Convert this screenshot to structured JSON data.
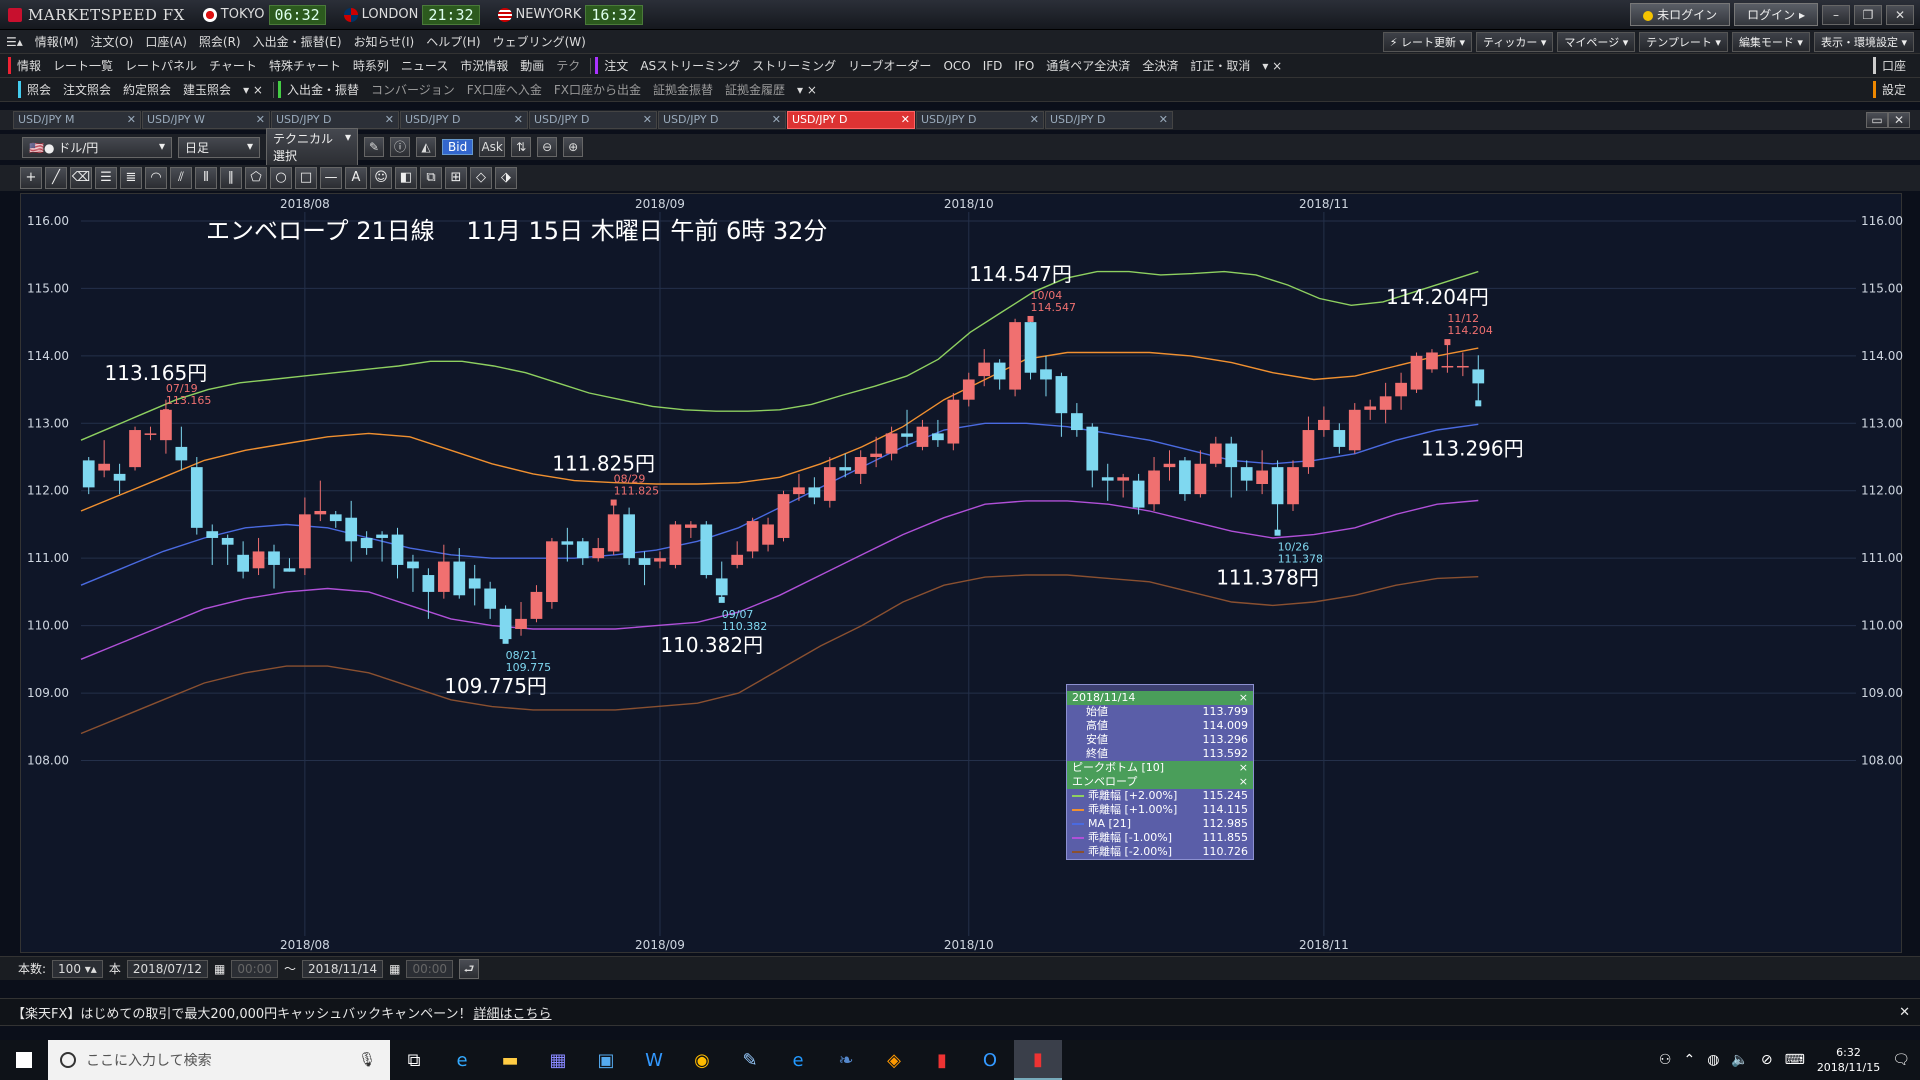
{
  "titlebar": {
    "app_name": "MARKETSPEED FX",
    "clocks": [
      {
        "city": "TOKYO",
        "time": "06:32"
      },
      {
        "city": "LONDON",
        "time": "21:32"
      },
      {
        "city": "NEWYORK",
        "time": "16:32"
      }
    ],
    "login_status": "未ログイン",
    "login_button": "ログイン"
  },
  "menubar": {
    "items": [
      "情報(M)",
      "注文(O)",
      "口座(A)",
      "照会(R)",
      "入出金・振替(E)",
      "お知らせ(I)",
      "ヘルプ(H)",
      "ウェブリング(W)"
    ],
    "right": [
      "レート更新",
      "ティッカー",
      "マイページ",
      "テンプレート",
      "編集モード",
      "表示・環境設定"
    ]
  },
  "funcbar": {
    "info_label": "情報",
    "info_items": [
      "レート一覧",
      "レートパネル",
      "チャート",
      "特殊チャート",
      "時系列",
      "ニュース",
      "市況情報",
      "動画",
      "テク"
    ],
    "order_label": "注文",
    "order_items": [
      "ASストリーミング",
      "ストリーミング",
      "リーブオーダー",
      "OCO",
      "IFD",
      "IFO",
      "通貨ペア全決済",
      "全決済",
      "訂正・取消"
    ],
    "right_label": "口座"
  },
  "funcbar2": {
    "inquiry_label": "照会",
    "inquiry_items": [
      "注文照会",
      "約定照会",
      "建玉照会"
    ],
    "transfer_label": "入出金・振替",
    "transfer_items": [
      "コンバージョン",
      "FX口座へ入金",
      "FX口座から出金",
      "証拠金振替",
      "証拠金履歴"
    ],
    "right_label": "設定"
  },
  "tabs": [
    "USD/JPY M",
    "USD/JPY W",
    "USD/JPY D",
    "USD/JPY D",
    "USD/JPY D",
    "USD/JPY D",
    "USD/JPY D",
    "USD/JPY D",
    "USD/JPY D"
  ],
  "active_tab_index": 6,
  "chart_tools": {
    "pair": "ドル/円",
    "period": "日足",
    "technical": "テクニカル選択",
    "bid": "Bid",
    "ask": "Ask"
  },
  "range": {
    "count_label": "本数:",
    "count_value": "100",
    "count_unit": "本",
    "from": "2018/07/12",
    "from_time": "00:00",
    "tilde": "～",
    "to": "2018/11/14",
    "to_time": "00:00"
  },
  "news": {
    "text": "【楽天FX】はじめての取引で最大200,000円キャッシュバックキャンペーン！",
    "link": "詳細はこちら"
  },
  "taskbar": {
    "search_placeholder": "ここに入力して検索",
    "time": "6:32",
    "date": "2018/11/15"
  },
  "colors": {
    "up_candle": "#f07070",
    "down_candle": "#7fd8f0",
    "env_plus2": "#8ed060",
    "env_plus1": "#f09030",
    "ma21": "#4a6ae0",
    "env_minus1": "#b050d8",
    "env_minus2": "#8a5030"
  },
  "chart_data": {
    "type": "candlestick",
    "title": "エンベロープ 21日線　 11月 15日 木曜日 午前 6時 32分",
    "yrange": [
      107.8,
      116.4
    ],
    "yticks": [
      "116.00",
      "115.00",
      "114.00",
      "113.00",
      "112.00",
      "111.00",
      "110.00",
      "109.00",
      "108.00"
    ],
    "month_labels": [
      {
        "label": "2018/08",
        "index": 14
      },
      {
        "label": "2018/09",
        "index": 37
      },
      {
        "label": "2018/10",
        "index": 57
      },
      {
        "label": "2018/11",
        "index": 80
      }
    ],
    "candles": [
      [
        112.45,
        112.05,
        112.5,
        111.95
      ],
      [
        112.3,
        112.4,
        112.75,
        112.2
      ],
      [
        112.25,
        112.15,
        112.4,
        111.95
      ],
      [
        112.35,
        112.9,
        112.95,
        112.3
      ],
      [
        112.85,
        112.85,
        112.95,
        112.75
      ],
      [
        112.75,
        113.2,
        113.35,
        112.55
      ],
      [
        112.65,
        112.45,
        112.95,
        112.3
      ],
      [
        112.35,
        111.45,
        112.5,
        111.35
      ],
      [
        111.4,
        111.3,
        111.5,
        110.9
      ],
      [
        111.3,
        111.2,
        111.35,
        110.9
      ],
      [
        111.05,
        110.8,
        111.25,
        110.7
      ],
      [
        110.85,
        111.1,
        111.3,
        110.75
      ],
      [
        111.1,
        110.9,
        111.2,
        110.55
      ],
      [
        110.85,
        110.8,
        111.0,
        110.8
      ],
      [
        110.85,
        111.65,
        111.9,
        110.75
      ],
      [
        111.65,
        111.7,
        112.15,
        111.55
      ],
      [
        111.65,
        111.55,
        111.7,
        111.45
      ],
      [
        111.6,
        111.25,
        111.85,
        110.95
      ],
      [
        111.3,
        111.15,
        111.4,
        111.05
      ],
      [
        111.35,
        111.3,
        111.4,
        110.95
      ],
      [
        111.35,
        110.9,
        111.45,
        110.7
      ],
      [
        110.95,
        110.85,
        111.05,
        110.5
      ],
      [
        110.75,
        110.5,
        110.85,
        110.1
      ],
      [
        110.5,
        110.95,
        111.2,
        110.4
      ],
      [
        110.95,
        110.45,
        111.15,
        110.4
      ],
      [
        110.7,
        110.55,
        110.9,
        110.3
      ],
      [
        110.55,
        110.25,
        110.65,
        110.1
      ],
      [
        110.25,
        109.8,
        110.3,
        109.78
      ],
      [
        109.95,
        110.1,
        110.35,
        109.85
      ],
      [
        110.1,
        110.5,
        110.6,
        110.05
      ],
      [
        110.35,
        111.25,
        111.3,
        110.25
      ],
      [
        111.25,
        111.2,
        111.45,
        110.95
      ],
      [
        111.25,
        111.0,
        111.3,
        110.9
      ],
      [
        111.0,
        111.15,
        111.3,
        110.95
      ],
      [
        111.1,
        111.65,
        111.83,
        111.05
      ],
      [
        111.65,
        111.0,
        111.75,
        110.9
      ],
      [
        111.0,
        110.9,
        111.1,
        110.6
      ],
      [
        110.95,
        111.0,
        111.1,
        110.85
      ],
      [
        110.9,
        111.5,
        111.55,
        110.85
      ],
      [
        111.45,
        111.5,
        111.55,
        111.3
      ],
      [
        111.5,
        110.75,
        111.55,
        110.7
      ],
      [
        110.7,
        110.45,
        110.95,
        110.38
      ],
      [
        110.9,
        111.05,
        111.25,
        110.85
      ],
      [
        111.1,
        111.55,
        111.6,
        111.0
      ],
      [
        111.2,
        111.5,
        111.6,
        111.1
      ],
      [
        111.3,
        111.95,
        112.0,
        111.25
      ],
      [
        111.95,
        112.05,
        112.25,
        111.85
      ],
      [
        112.05,
        111.9,
        112.2,
        111.8
      ],
      [
        111.85,
        112.35,
        112.5,
        111.75
      ],
      [
        112.35,
        112.3,
        112.55,
        112.2
      ],
      [
        112.25,
        112.5,
        112.6,
        112.1
      ],
      [
        112.5,
        112.55,
        112.8,
        112.35
      ],
      [
        112.55,
        112.85,
        112.95,
        112.45
      ],
      [
        112.85,
        112.8,
        113.2,
        112.65
      ],
      [
        112.65,
        112.95,
        113.05,
        112.6
      ],
      [
        112.85,
        112.75,
        113.05,
        112.65
      ],
      [
        112.7,
        113.35,
        113.45,
        112.6
      ],
      [
        113.35,
        113.65,
        113.75,
        113.25
      ],
      [
        113.7,
        113.9,
        114.1,
        113.55
      ],
      [
        113.9,
        113.65,
        113.95,
        113.5
      ],
      [
        113.5,
        114.5,
        114.55,
        113.4
      ],
      [
        114.5,
        113.75,
        114.547,
        113.65
      ],
      [
        113.8,
        113.65,
        114.0,
        113.4
      ],
      [
        113.7,
        113.15,
        113.75,
        112.8
      ],
      [
        113.15,
        112.9,
        113.3,
        112.8
      ],
      [
        112.95,
        112.3,
        113.0,
        112.05
      ],
      [
        112.2,
        112.15,
        112.4,
        111.85
      ],
      [
        112.15,
        112.2,
        112.25,
        111.9
      ],
      [
        112.15,
        111.75,
        112.25,
        111.65
      ],
      [
        111.8,
        112.3,
        112.5,
        111.7
      ],
      [
        112.35,
        112.4,
        112.6,
        112.15
      ],
      [
        112.45,
        111.95,
        112.5,
        111.85
      ],
      [
        111.95,
        112.4,
        112.6,
        111.9
      ],
      [
        112.4,
        112.7,
        112.8,
        112.35
      ],
      [
        112.7,
        112.35,
        112.8,
        111.9
      ],
      [
        112.35,
        112.15,
        112.45,
        112.0
      ],
      [
        112.1,
        112.3,
        112.6,
        111.95
      ],
      [
        112.35,
        111.8,
        112.45,
        111.378
      ],
      [
        111.8,
        112.35,
        112.45,
        111.7
      ],
      [
        112.35,
        112.9,
        113.1,
        112.25
      ],
      [
        112.9,
        113.05,
        113.25,
        112.8
      ],
      [
        112.9,
        112.65,
        113.0,
        112.55
      ],
      [
        112.6,
        113.2,
        113.3,
        112.55
      ],
      [
        113.2,
        113.25,
        113.35,
        113.05
      ],
      [
        113.2,
        113.4,
        113.6,
        113.0
      ],
      [
        113.4,
        113.6,
        113.75,
        113.2
      ],
      [
        113.5,
        114.0,
        114.05,
        113.45
      ],
      [
        113.8,
        114.05,
        114.1,
        113.75
      ],
      [
        113.85,
        113.85,
        114.204,
        113.75
      ],
      [
        113.85,
        113.85,
        114.05,
        113.7
      ],
      [
        113.799,
        113.592,
        114.009,
        113.296
      ]
    ],
    "envelopes": [
      {
        "name": "乖離幅 [+2.00%]",
        "color": "#8ed060",
        "values": [
          112.75,
          112.95,
          113.15,
          113.35,
          113.5,
          113.6,
          113.65,
          113.7,
          113.75,
          113.8,
          113.85,
          113.92,
          113.92,
          113.85,
          113.75,
          113.6,
          113.45,
          113.35,
          113.25,
          113.2,
          113.18,
          113.18,
          113.2,
          113.28,
          113.42,
          113.55,
          113.7,
          113.95,
          114.35,
          114.65,
          114.95,
          115.15,
          115.25,
          115.25,
          115.2,
          115.22,
          115.25,
          115.2,
          115.05,
          114.85,
          114.75,
          114.8,
          114.95,
          115.1,
          115.25
        ]
      },
      {
        "name": "乖離幅 [+1.00%]",
        "color": "#f09030",
        "values": [
          111.7,
          111.95,
          112.2,
          112.45,
          112.6,
          112.7,
          112.8,
          112.85,
          112.8,
          112.6,
          112.4,
          112.25,
          112.15,
          112.12,
          112.1,
          112.1,
          112.12,
          112.2,
          112.4,
          112.65,
          112.95,
          113.35,
          113.65,
          113.95,
          114.05,
          114.05,
          114.05,
          114.0,
          113.9,
          113.75,
          113.65,
          113.7,
          113.85,
          114.0,
          114.115
        ]
      },
      {
        "name": "MA [21]",
        "color": "#4a6ae0",
        "values": [
          110.6,
          110.85,
          111.1,
          111.3,
          111.45,
          111.5,
          111.45,
          111.3,
          111.15,
          111.05,
          111.0,
          111.0,
          111.0,
          111.05,
          111.12,
          111.25,
          111.45,
          111.75,
          112.05,
          112.35,
          112.65,
          112.9,
          113.0,
          113.0,
          112.95,
          112.85,
          112.75,
          112.6,
          112.45,
          112.4,
          112.45,
          112.55,
          112.75,
          112.9,
          112.985
        ]
      },
      {
        "name": "乖離幅 [-1.00%]",
        "color": "#b050d8",
        "values": [
          109.5,
          109.75,
          110.0,
          110.25,
          110.4,
          110.5,
          110.55,
          110.5,
          110.3,
          110.1,
          110.0,
          109.95,
          109.95,
          109.95,
          110.0,
          110.05,
          110.2,
          110.45,
          110.75,
          111.05,
          111.35,
          111.6,
          111.8,
          111.85,
          111.85,
          111.8,
          111.7,
          111.55,
          111.4,
          111.3,
          111.35,
          111.45,
          111.65,
          111.8,
          111.855
        ]
      },
      {
        "name": "乖離幅 [-2.00%]",
        "color": "#8a5030",
        "values": [
          108.4,
          108.65,
          108.9,
          109.15,
          109.3,
          109.4,
          109.4,
          109.3,
          109.1,
          108.9,
          108.8,
          108.75,
          108.75,
          108.75,
          108.8,
          108.85,
          109.0,
          109.35,
          109.7,
          110.0,
          110.35,
          110.6,
          110.72,
          110.75,
          110.75,
          110.7,
          110.65,
          110.5,
          110.35,
          110.3,
          110.35,
          110.45,
          110.6,
          110.7,
          110.726
        ]
      }
    ],
    "annotations": [
      {
        "index": 5,
        "price": 113.165,
        "date": "07/19",
        "value": "113.165",
        "big": "113.165円",
        "side": "high"
      },
      {
        "index": 27,
        "price": 109.775,
        "date": "08/21",
        "value": "109.775",
        "big": "109.775円",
        "side": "low"
      },
      {
        "index": 34,
        "price": 111.825,
        "date": "08/29",
        "value": "111.825",
        "big": "111.825円",
        "side": "high"
      },
      {
        "index": 41,
        "price": 110.382,
        "date": "09/07",
        "value": "110.382",
        "big": "110.382円",
        "side": "low"
      },
      {
        "index": 61,
        "price": 114.547,
        "date": "10/04",
        "value": "114.547",
        "big": "114.547円",
        "side": "high"
      },
      {
        "index": 77,
        "price": 111.378,
        "date": "10/26",
        "value": "111.378",
        "big": "111.378円",
        "side": "low"
      },
      {
        "index": 88,
        "price": 114.204,
        "date": "11/12",
        "value": "114.204",
        "big": "114.204円",
        "side": "high"
      },
      {
        "index": 90,
        "price": 113.296,
        "date": "",
        "value": "",
        "big": "113.296円",
        "side": "low"
      }
    ],
    "info_panel": {
      "date": "2018/11/14",
      "ohlc": [
        {
          "label": "始値",
          "value": "113.799"
        },
        {
          "label": "高値",
          "value": "114.009"
        },
        {
          "label": "安値",
          "value": "113.296"
        },
        {
          "label": "終値",
          "value": "113.592"
        }
      ],
      "section1": "ピークボトム [10]",
      "section2": "エンベロープ",
      "lines": [
        {
          "label": "乖離幅 [+2.00%]",
          "value": "115.245",
          "color": "#8ed060"
        },
        {
          "label": "乖離幅 [+1.00%]",
          "value": "114.115",
          "color": "#f09030"
        },
        {
          "label": "MA [21]",
          "value": "112.985",
          "color": "#4a6ae0"
        },
        {
          "label": "乖離幅 [-1.00%]",
          "value": "111.855",
          "color": "#b050d8"
        },
        {
          "label": "乖離幅 [-2.00%]",
          "value": "110.726",
          "color": "#8a5030"
        }
      ]
    }
  }
}
